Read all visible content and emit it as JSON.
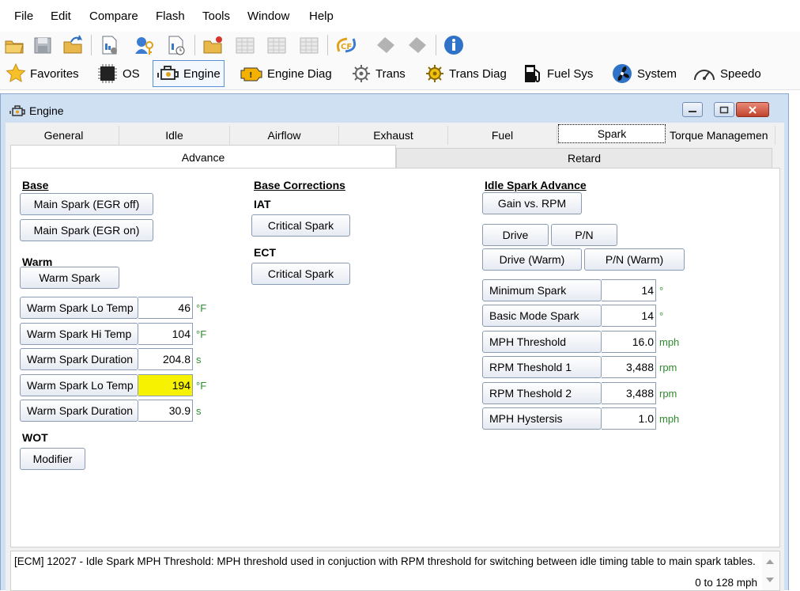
{
  "menu": [
    "File",
    "Edit",
    "Compare",
    "Flash",
    "Tools",
    "Window",
    "Help"
  ],
  "categories": [
    {
      "label": "Favorites",
      "icon": "star-icon"
    },
    {
      "label": "OS",
      "icon": "chip-icon"
    },
    {
      "label": "Engine",
      "icon": "engine-icon",
      "active": true
    },
    {
      "label": "Engine Diag",
      "icon": "check-engine-icon"
    },
    {
      "label": "Trans",
      "icon": "gear-icon"
    },
    {
      "label": "Trans Diag",
      "icon": "gear-warning-icon"
    },
    {
      "label": "Fuel Sys",
      "icon": "fuel-pump-icon"
    },
    {
      "label": "System",
      "icon": "fan-icon"
    },
    {
      "label": "Speedo",
      "icon": "speedometer-icon"
    }
  ],
  "window": {
    "title": "Engine"
  },
  "tabs": [
    "General",
    "Idle",
    "Airflow",
    "Exhaust",
    "Fuel",
    "Spark",
    "Torque Managemen"
  ],
  "active_tab": "Spark",
  "subtabs": [
    "Advance",
    "Retard"
  ],
  "active_subtab": "Advance",
  "base": {
    "heading": "Base",
    "btn_main_egr_off": "Main Spark (EGR off)",
    "btn_main_egr_on": "Main Spark (EGR on)"
  },
  "warm": {
    "heading": "Warm",
    "btn_warm_spark": "Warm Spark",
    "rows": [
      {
        "label": "Warm Spark Lo Temp",
        "value": "46",
        "unit": "°F"
      },
      {
        "label": "Warm Spark Hi Temp",
        "value": "104",
        "unit": "°F"
      },
      {
        "label": "Warm Spark Duration",
        "value": "204.8",
        "unit": "s"
      },
      {
        "label": "Warm Spark Lo Temp",
        "value": "194",
        "unit": "°F",
        "highlight": true
      },
      {
        "label": "Warm Spark Duration",
        "value": "30.9",
        "unit": "s"
      }
    ]
  },
  "wot": {
    "heading": "WOT",
    "btn_modifier": "Modifier"
  },
  "base_corrections": {
    "heading": "Base Corrections",
    "iat_label": "IAT",
    "iat_btn": "Critical Spark",
    "ect_label": "ECT",
    "ect_btn": "Critical Spark"
  },
  "idle_spark": {
    "heading": "Idle Spark Advance",
    "btn_gain": "Gain vs. RPM",
    "btn_drive": "Drive",
    "btn_pn": "P/N",
    "btn_drive_warm": "Drive (Warm)",
    "btn_pn_warm": "P/N (Warm)",
    "rows": [
      {
        "label": "Minimum Spark",
        "value": "14",
        "unit": "°"
      },
      {
        "label": "Basic Mode Spark",
        "value": "14",
        "unit": "°"
      },
      {
        "label": "MPH Threshold",
        "value": "16.0",
        "unit": "mph"
      },
      {
        "label": "RPM Theshold 1",
        "value": "3,488",
        "unit": "rpm"
      },
      {
        "label": "RPM Theshold 2",
        "value": "3,488",
        "unit": "rpm"
      },
      {
        "label": "MPH Hystersis",
        "value": "1.0",
        "unit": "mph"
      }
    ]
  },
  "status": {
    "text": "[ECM] 12027 - Idle Spark MPH Threshold: MPH threshold used in conjuction with RPM threshold for switching between idle timing table to main spark tables.",
    "range": "0 to 128 mph"
  },
  "colors": {
    "highlight": "#f7f200",
    "unit": "#2e8b2e",
    "window_frame": "#cfe0f3"
  }
}
